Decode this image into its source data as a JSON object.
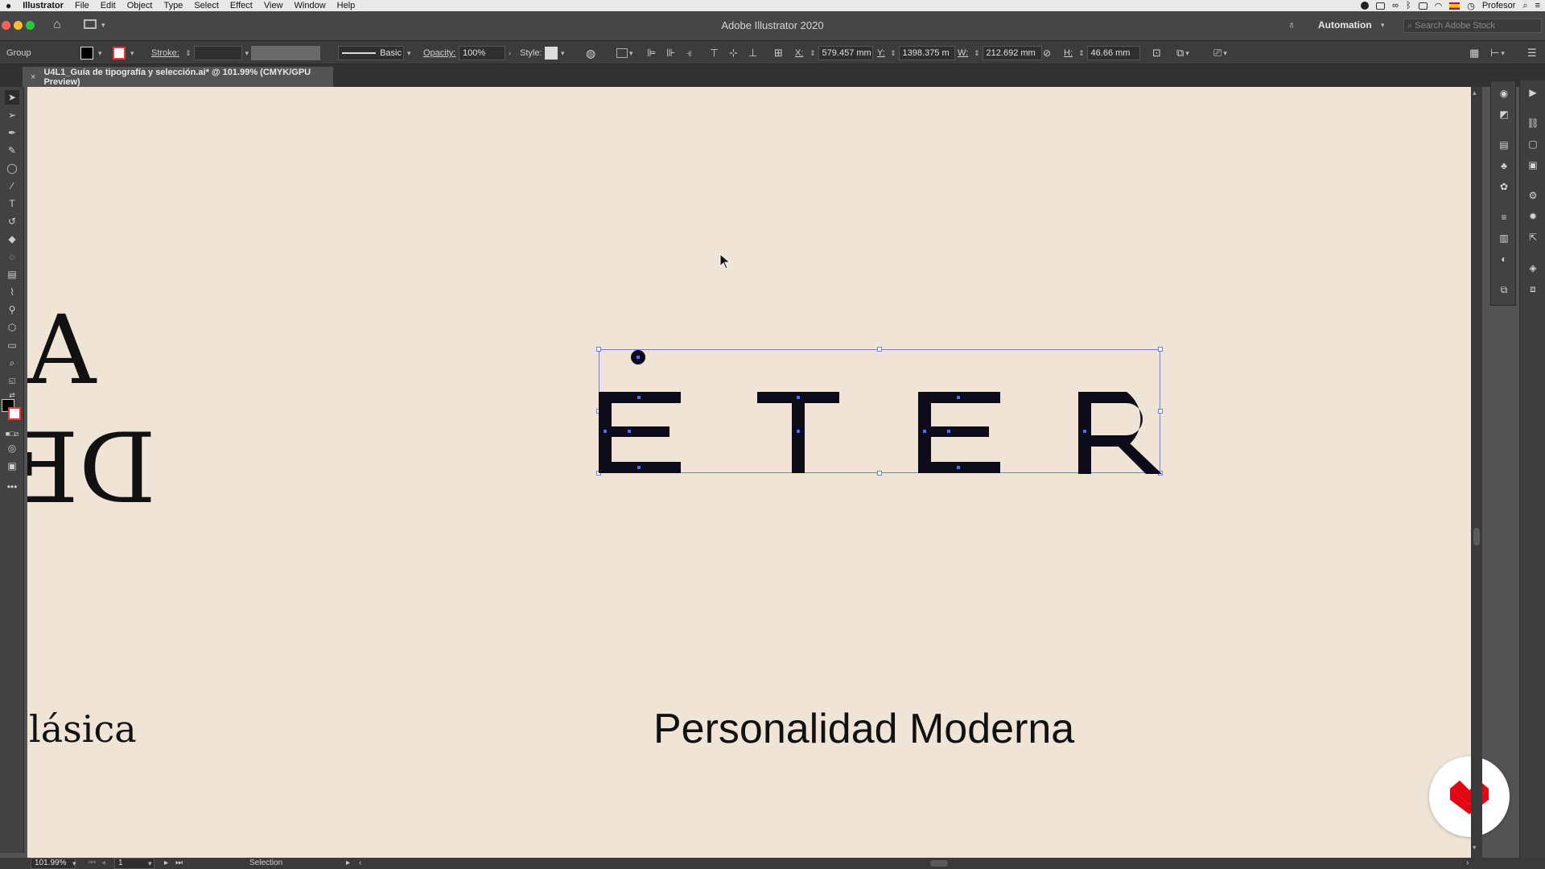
{
  "menubar": {
    "apple": "",
    "app": "Illustrator",
    "items": [
      "File",
      "Edit",
      "Object",
      "Type",
      "Select",
      "Effect",
      "View",
      "Window",
      "Help"
    ],
    "user": "Profesor"
  },
  "appbar": {
    "title": "Adobe Illustrator 2020",
    "workspace": "Automation",
    "search_placeholder": "Search Adobe Stock"
  },
  "control": {
    "selection_type": "Group",
    "stroke_label": "Stroke:",
    "brush": "Basic",
    "opacity_label": "Opacity:",
    "opacity": "100%",
    "style_label": "Style:",
    "x_label": "X:",
    "x": "579.457 mm",
    "y_label": "Y:",
    "y": "1398.375 m",
    "w_label": "W:",
    "w": "212.692 mm",
    "h_label": "H:",
    "h": "46.66 mm"
  },
  "document": {
    "tab_label": "U4L1_Guía de tipografía y selección.ai* @ 101.99% (CMYK/GPU Preview)",
    "close": "×"
  },
  "canvas": {
    "letter_a": "A",
    "letters_de": "DE",
    "label_clasica": "lásica",
    "label_moderna": "Personalidad Moderna"
  },
  "status": {
    "zoom": "101.99%",
    "artboard": "1",
    "tool": "Selection"
  },
  "colors": {
    "canvas": "#efe4d6",
    "glyph": "#0b0b1a",
    "selection": "#4f6bff",
    "logo": "#e30613"
  }
}
